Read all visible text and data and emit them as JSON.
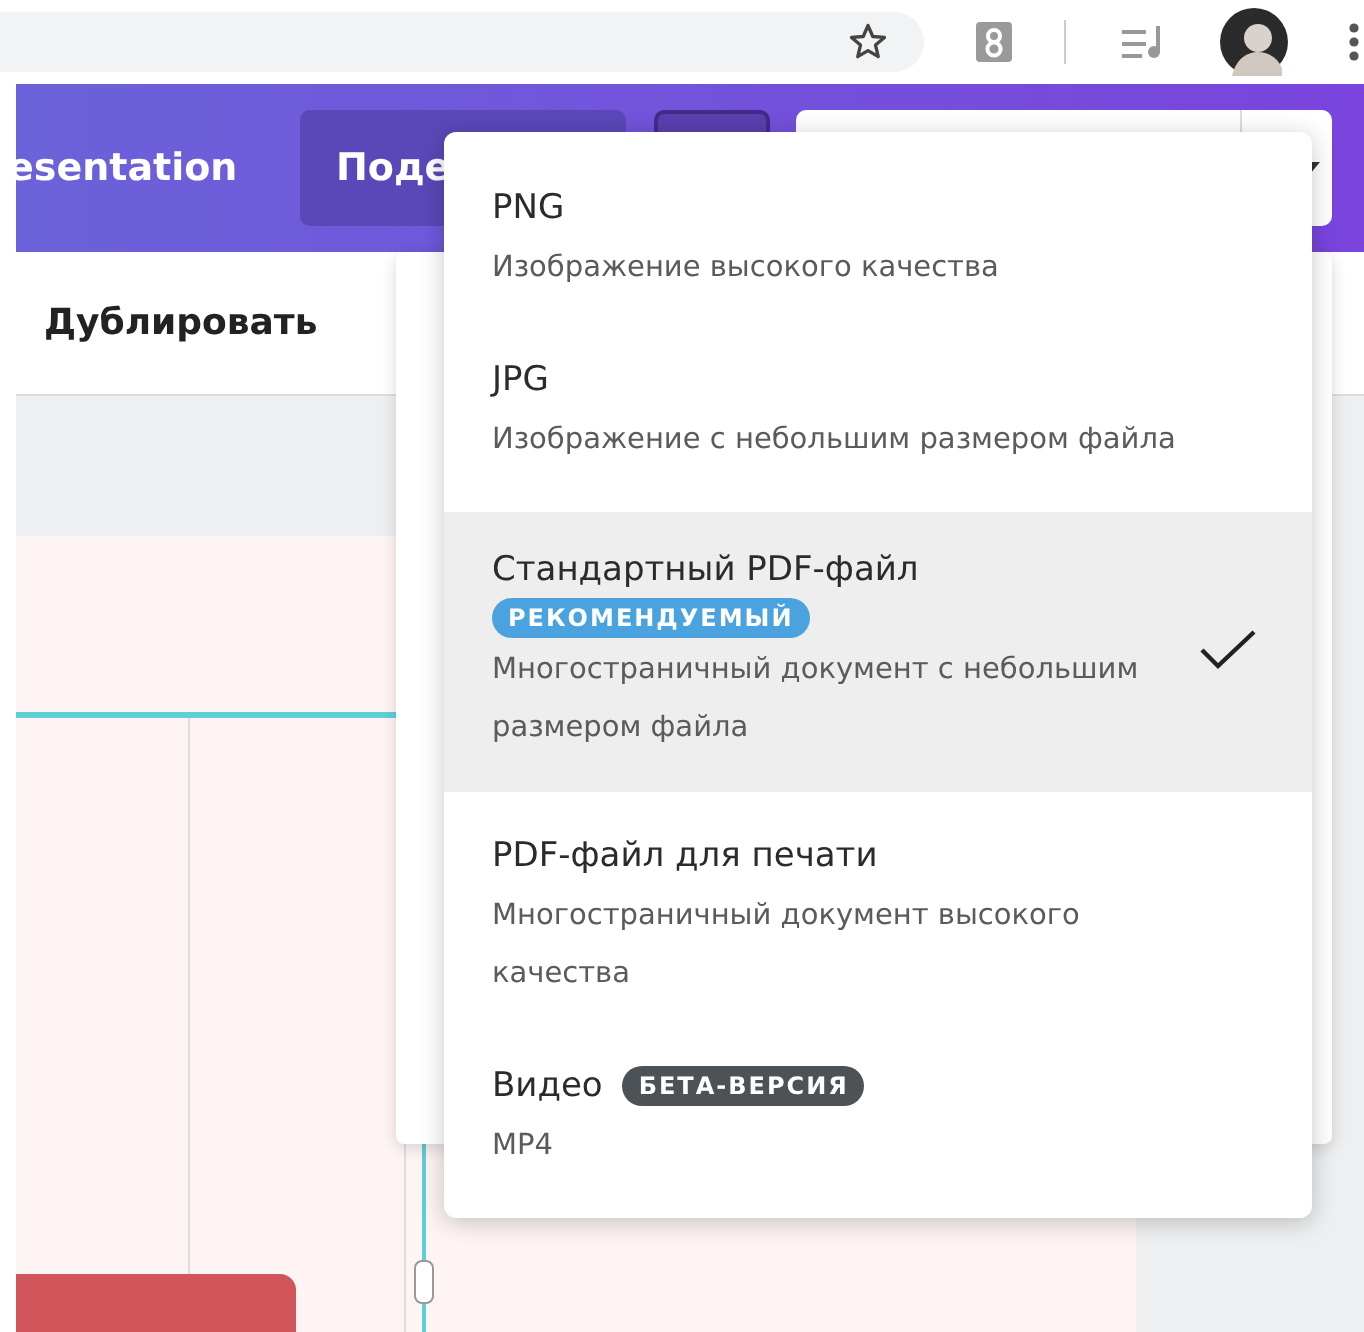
{
  "header": {
    "title": "esentation",
    "share_button": "Поде"
  },
  "toolbar": {
    "duplicate_button": "Дублировать"
  },
  "download_menu": {
    "items": [
      {
        "title": "PNG",
        "description": "Изображение высокого качества",
        "selected": false
      },
      {
        "title": "JPG",
        "description": "Изображение с небольшим размером файла",
        "selected": false
      },
      {
        "title": "Стандартный PDF-файл",
        "kind": "stacked",
        "badge": {
          "label": "РЕКОМЕНДУЕМЫЙ",
          "color": "#4aa3df"
        },
        "description": "Многостраничный документ с небольшим размером файла",
        "selected": true
      },
      {
        "title": "PDF-файл для печати",
        "description": "Многостраничный документ высокого качества",
        "selected": false
      },
      {
        "title": "Видео",
        "kind": "inline",
        "badge": {
          "label": "БЕТА-ВЕРСИЯ",
          "color": "#4d5257"
        },
        "description": "MP4",
        "selected": false
      }
    ]
  }
}
